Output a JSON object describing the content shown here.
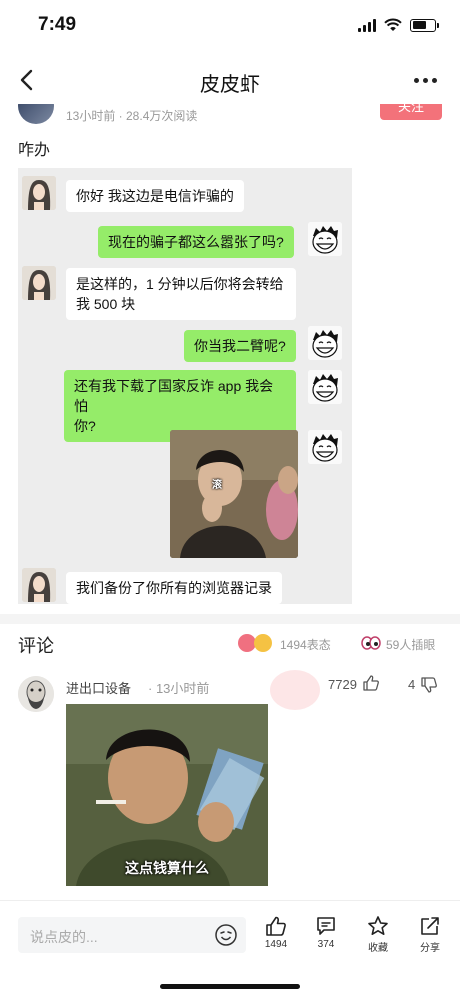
{
  "status_bar": {
    "time": "7:49"
  },
  "nav": {
    "title": "皮皮虾"
  },
  "post": {
    "meta": "13小时前 · 28.4万次阅读",
    "follow_label": "关注",
    "title": "咋办"
  },
  "chat": {
    "messages": [
      {
        "side": "left",
        "text": "你好 我这边是电信诈骗的"
      },
      {
        "side": "right",
        "text": "现在的骗子都这么嚣张了吗?"
      },
      {
        "side": "left",
        "text_line1": "是这样的，1 分钟以后你将会转给",
        "text_line2": "我 500 块"
      },
      {
        "side": "right",
        "text": "你当我二臂呢?"
      },
      {
        "side": "right",
        "text_line1": "还有我下载了国家反诈 app 我会怕",
        "text_line2": "你?"
      },
      {
        "side": "right",
        "meme_caption": "滚"
      },
      {
        "side": "left",
        "text": "我们备份了你所有的浏览器记录"
      }
    ]
  },
  "comments_header": {
    "title": "评论",
    "reactions_count": "1494表态",
    "viewers_count": "59人插眼"
  },
  "comment": {
    "user": "进出口设备",
    "time": "· 13小时前",
    "likes": "7729",
    "dislikes": "4",
    "image_caption": "这点钱算什么"
  },
  "bottom_bar": {
    "input_placeholder": "说点皮的...",
    "actions": [
      {
        "icon": "thumbs-up-icon",
        "label": "1494"
      },
      {
        "icon": "comment-icon",
        "label": "374"
      },
      {
        "icon": "star-icon",
        "label": "收藏"
      },
      {
        "icon": "share-icon",
        "label": "分享"
      }
    ]
  },
  "colors": {
    "accent_pink": "#f3727a",
    "chat_bubble_green": "#95ec69",
    "chat_background": "#ededed"
  }
}
